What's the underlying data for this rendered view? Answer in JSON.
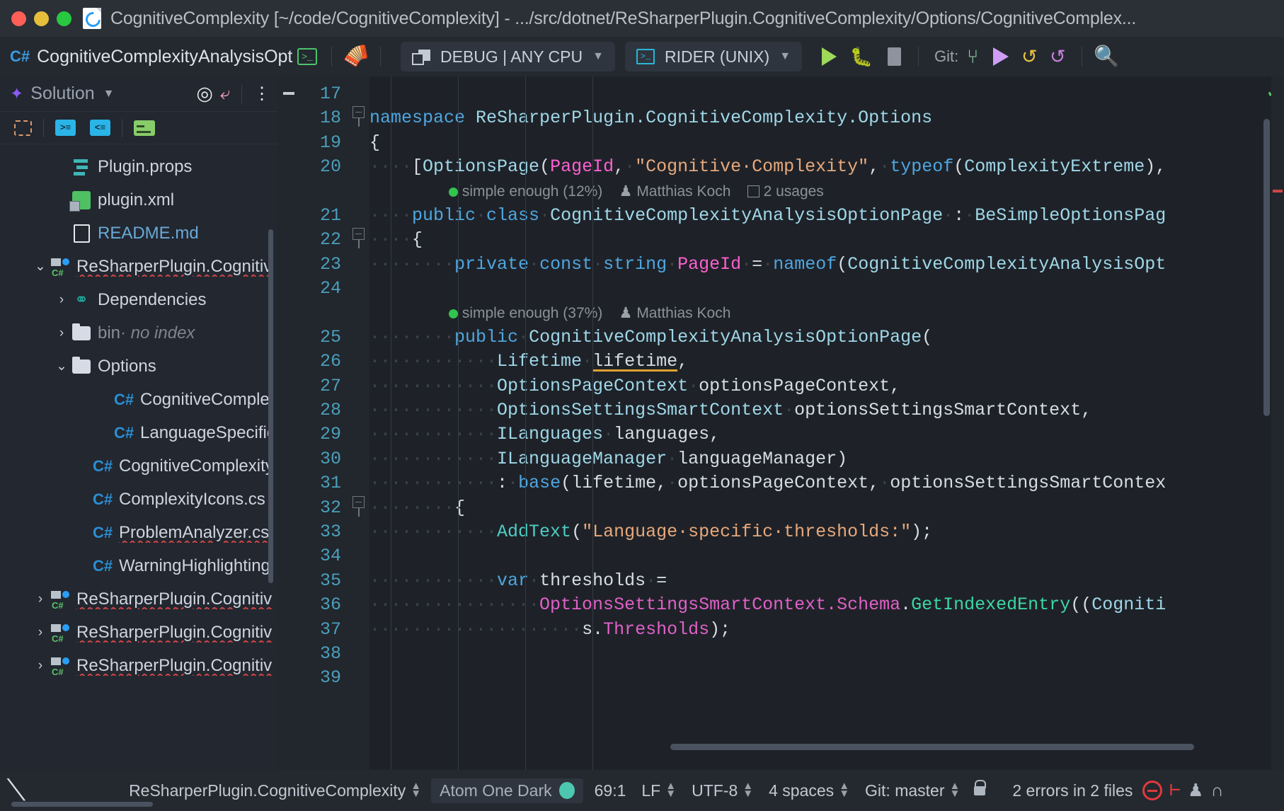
{
  "titlebar": {
    "title": "CognitiveComplexity [~/code/CognitiveComplexity] - .../src/dotnet/ReSharperPlugin.CognitiveComplexity/Options/CognitiveComplex...",
    "window_controls": [
      "close",
      "minimize",
      "maximize"
    ],
    "project_icon": "rider-project-icon"
  },
  "toolbar": {
    "file_badge": "C#",
    "file_name": "CognitiveComplexityAnalysisOptionP",
    "terminal_icon": "terminal-icon",
    "build_icon": "hammer-icon",
    "config_label": "DEBUG | ANY CPU",
    "run_config_label": "RIDER (UNIX)",
    "run_label": "run-button",
    "debug_label": "debug-button",
    "stop_label": "stop-button",
    "git_label": "Git:",
    "git_branch_icon": "branch-icon",
    "git_push_icon": "push-icon",
    "git_update_icon": "update-project-icon",
    "git_history_icon": "rollback-icon",
    "search_icon": "search-everywhere-icon"
  },
  "sidebar": {
    "title": "Solution",
    "logo_icon": "solution-icon",
    "chevron_icon": "chevron-down-icon",
    "header_actions": [
      "locate-icon",
      "collapse-all-icon",
      "options-menu-icon"
    ],
    "toolbar_actions": [
      "select-opened-file-icon",
      "expand-icon",
      "collapse-icon",
      "settings-file-icon"
    ],
    "tree": [
      {
        "label": "Plugin.props",
        "icon": "props-file-icon",
        "indent": 2,
        "twisty": "none",
        "style": "normal"
      },
      {
        "label": "plugin.xml",
        "icon": "xml-file-icon",
        "indent": 2,
        "twisty": "none",
        "style": "normal"
      },
      {
        "label": "README.md",
        "icon": "markdown-file-icon",
        "indent": 2,
        "twisty": "none",
        "style": "link"
      },
      {
        "label": "ReSharperPlugin.Cognitiv",
        "icon": "csproj-icon",
        "indent": 1,
        "twisty": "expanded",
        "style": "squiggle"
      },
      {
        "label": "Dependencies",
        "icon": "dependencies-icon",
        "indent": 2,
        "twisty": "collapsed",
        "style": "normal"
      },
      {
        "label": "bin",
        "suffix": " · no index",
        "icon": "folder-icon",
        "indent": 2,
        "twisty": "collapsed",
        "style": "dim"
      },
      {
        "label": "Options",
        "icon": "folder-icon",
        "indent": 2,
        "twisty": "expanded",
        "style": "normal"
      },
      {
        "label": "CognitiveComplexity",
        "icon": "cs-file-icon",
        "indent": 4,
        "twisty": "none",
        "style": "normal"
      },
      {
        "label": "LanguageSpecificCo",
        "icon": "cs-file-icon",
        "indent": 4,
        "twisty": "none",
        "style": "normal"
      },
      {
        "label": "CognitiveComplexityAr",
        "icon": "cs-file-icon",
        "indent": 3,
        "twisty": "none",
        "style": "normal"
      },
      {
        "label": "ComplexityIcons.cs",
        "icon": "cs-file-icon",
        "indent": 3,
        "twisty": "none",
        "style": "normal"
      },
      {
        "label": "ProblemAnalyzer.cs",
        "icon": "cs-file-icon",
        "indent": 3,
        "twisty": "none",
        "style": "squiggle"
      },
      {
        "label": "WarningHighlighting.c",
        "icon": "cs-file-icon",
        "indent": 3,
        "twisty": "none",
        "style": "normal"
      },
      {
        "label": "ReSharperPlugin.Cognitiv",
        "icon": "csproj-icon",
        "indent": 1,
        "twisty": "collapsed",
        "style": "squiggle"
      },
      {
        "label": "ReSharperPlugin.Cognitiv",
        "icon": "csproj-icon",
        "indent": 1,
        "twisty": "collapsed",
        "style": "squiggle"
      },
      {
        "label": "ReSharperPlugin.Cognitiv",
        "icon": "csproj-icon",
        "indent": 1,
        "twisty": "collapsed",
        "style": "squiggle"
      }
    ]
  },
  "editor": {
    "line_numbers": [
      "17",
      "18",
      "19",
      "20",
      "21",
      "22",
      "23",
      "24",
      "25",
      "26",
      "27",
      "28",
      "29",
      "30",
      "31",
      "32",
      "33",
      "34",
      "35",
      "36",
      "37",
      "38",
      "39"
    ],
    "lines": [
      {
        "num": "17",
        "segments": []
      },
      {
        "num": "18",
        "segments": [
          {
            "t": "namespace",
            "c": "kw"
          },
          {
            "t": " ",
            "c": "dots"
          },
          {
            "t": "ReSharperPlugin.CognitiveComplexity.Options",
            "c": "type"
          }
        ]
      },
      {
        "num": "19",
        "segments": [
          {
            "t": "{",
            "c": "plain"
          }
        ]
      },
      {
        "num": "20",
        "segments": [
          {
            "t": "····",
            "c": "dots"
          },
          {
            "t": "[",
            "c": "plain"
          },
          {
            "t": "OptionsPage",
            "c": "type"
          },
          {
            "t": "(",
            "c": "plain"
          },
          {
            "t": "PageId",
            "c": "magenta"
          },
          {
            "t": ",",
            "c": "plain"
          },
          {
            "t": "·",
            "c": "dots"
          },
          {
            "t": "\"Cognitive·Complexity\"",
            "c": "str"
          },
          {
            "t": ",",
            "c": "plain"
          },
          {
            "t": "·",
            "c": "dots"
          },
          {
            "t": "typeof",
            "c": "kw"
          },
          {
            "t": "(",
            "c": "plain"
          },
          {
            "t": "ComplexityExtreme",
            "c": "type"
          },
          {
            "t": ")",
            "c": "plain"
          },
          {
            "t": ",",
            "c": "plain"
          }
        ]
      },
      {
        "num": "",
        "hint": true,
        "codelens": {
          "complexity": "simple enough (12%)",
          "author": "Matthias Koch",
          "usages": "2 usages"
        }
      },
      {
        "num": "21",
        "segments": [
          {
            "t": "····",
            "c": "dots"
          },
          {
            "t": "public",
            "c": "kw"
          },
          {
            "t": "·",
            "c": "dots"
          },
          {
            "t": "class",
            "c": "kw"
          },
          {
            "t": "·",
            "c": "dots"
          },
          {
            "t": "CognitiveComplexityAnalysisOptionPage",
            "c": "type"
          },
          {
            "t": "·",
            "c": "dots"
          },
          {
            "t": ":",
            "c": "plain"
          },
          {
            "t": "·",
            "c": "dots"
          },
          {
            "t": "BeSimpleOptionsPag",
            "c": "type"
          }
        ]
      },
      {
        "num": "22",
        "segments": [
          {
            "t": "····",
            "c": "dots"
          },
          {
            "t": "{",
            "c": "plain"
          }
        ]
      },
      {
        "num": "23",
        "segments": [
          {
            "t": "········",
            "c": "dots"
          },
          {
            "t": "private",
            "c": "kw"
          },
          {
            "t": "·",
            "c": "dots"
          },
          {
            "t": "const",
            "c": "kw"
          },
          {
            "t": "·",
            "c": "dots"
          },
          {
            "t": "string",
            "c": "kw"
          },
          {
            "t": "·",
            "c": "dots"
          },
          {
            "t": "PageId",
            "c": "magenta"
          },
          {
            "t": "·",
            "c": "dots"
          },
          {
            "t": "=",
            "c": "plain"
          },
          {
            "t": "·",
            "c": "dots"
          },
          {
            "t": "nameof",
            "c": "kw"
          },
          {
            "t": "(",
            "c": "plain"
          },
          {
            "t": "CognitiveComplexityAnalysisOpt",
            "c": "type"
          }
        ]
      },
      {
        "num": "24",
        "segments": []
      },
      {
        "num": "",
        "hint": true,
        "codelens": {
          "complexity": "simple enough (37%)",
          "author": "Matthias Koch",
          "usages": ""
        }
      },
      {
        "num": "25",
        "segments": [
          {
            "t": "········",
            "c": "dots"
          },
          {
            "t": "public",
            "c": "kw"
          },
          {
            "t": "·",
            "c": "dots"
          },
          {
            "t": "CognitiveComplexityAnalysisOptionPage",
            "c": "type"
          },
          {
            "t": "(",
            "c": "plain"
          }
        ]
      },
      {
        "num": "26",
        "segments": [
          {
            "t": "············",
            "c": "dots"
          },
          {
            "t": "Lifetime",
            "c": "type"
          },
          {
            "t": "·",
            "c": "dots"
          },
          {
            "t": "lifetime",
            "c": "plain und-orange"
          },
          {
            "t": ",",
            "c": "plain"
          }
        ]
      },
      {
        "num": "27",
        "segments": [
          {
            "t": "············",
            "c": "dots"
          },
          {
            "t": "OptionsPageContext",
            "c": "type"
          },
          {
            "t": "·",
            "c": "dots"
          },
          {
            "t": "optionsPageContext",
            "c": "plain"
          },
          {
            "t": ",",
            "c": "plain"
          }
        ]
      },
      {
        "num": "28",
        "segments": [
          {
            "t": "············",
            "c": "dots"
          },
          {
            "t": "OptionsSettingsSmartContext",
            "c": "type"
          },
          {
            "t": "·",
            "c": "dots"
          },
          {
            "t": "optionsSettingsSmartContext",
            "c": "plain"
          },
          {
            "t": ",",
            "c": "plain"
          }
        ]
      },
      {
        "num": "29",
        "segments": [
          {
            "t": "············",
            "c": "dots"
          },
          {
            "t": "ILanguages",
            "c": "type"
          },
          {
            "t": "·",
            "c": "dots"
          },
          {
            "t": "languages",
            "c": "plain"
          },
          {
            "t": ",",
            "c": "plain"
          }
        ]
      },
      {
        "num": "30",
        "segments": [
          {
            "t": "············",
            "c": "dots"
          },
          {
            "t": "ILanguageManager",
            "c": "type"
          },
          {
            "t": "·",
            "c": "dots"
          },
          {
            "t": "languageManager",
            "c": "plain"
          },
          {
            "t": ")",
            "c": "plain"
          }
        ]
      },
      {
        "num": "31",
        "segments": [
          {
            "t": "············",
            "c": "dots"
          },
          {
            "t": ":",
            "c": "plain"
          },
          {
            "t": "·",
            "c": "dots"
          },
          {
            "t": "base",
            "c": "kw"
          },
          {
            "t": "(",
            "c": "plain"
          },
          {
            "t": "lifetime,",
            "c": "plain"
          },
          {
            "t": "·",
            "c": "dots"
          },
          {
            "t": "optionsPageContext,",
            "c": "plain"
          },
          {
            "t": "·",
            "c": "dots"
          },
          {
            "t": "optionsSettingsSmartContex",
            "c": "plain"
          }
        ]
      },
      {
        "num": "32",
        "segments": [
          {
            "t": "········",
            "c": "dots"
          },
          {
            "t": "{",
            "c": "plain"
          }
        ]
      },
      {
        "num": "33",
        "segments": [
          {
            "t": "············",
            "c": "dots"
          },
          {
            "t": "AddText",
            "c": "meth"
          },
          {
            "t": "(",
            "c": "plain"
          },
          {
            "t": "\"Language·specific·thresholds:\"",
            "c": "str"
          },
          {
            "t": ")",
            "c": "plain"
          },
          {
            "t": ";",
            "c": "plain"
          }
        ]
      },
      {
        "num": "34",
        "segments": []
      },
      {
        "num": "35",
        "segments": [
          {
            "t": "············",
            "c": "dots"
          },
          {
            "t": "var",
            "c": "kw"
          },
          {
            "t": "·",
            "c": "dots"
          },
          {
            "t": "thresholds",
            "c": "plain"
          },
          {
            "t": "·",
            "c": "dots"
          },
          {
            "t": "=",
            "c": "plain"
          }
        ]
      },
      {
        "num": "36",
        "segments": [
          {
            "t": "················",
            "c": "dots"
          },
          {
            "t": "OptionsSettingsSmartContext.Schema",
            "c": "pink"
          },
          {
            "t": ".",
            "c": "plain"
          },
          {
            "t": "GetIndexedEntry",
            "c": "greenm"
          },
          {
            "t": "((",
            "c": "plain"
          },
          {
            "t": "Cogniti",
            "c": "type"
          }
        ]
      },
      {
        "num": "37",
        "segments": [
          {
            "t": "····················",
            "c": "dots"
          },
          {
            "t": "s",
            "c": "plain"
          },
          {
            "t": ".",
            "c": "plain"
          },
          {
            "t": "Thresholds",
            "c": "pink"
          },
          {
            "t": ")",
            "c": "plain"
          },
          {
            "t": ";",
            "c": "plain"
          }
        ]
      },
      {
        "num": "38",
        "segments": []
      },
      {
        "num": "39",
        "segments": []
      }
    ],
    "analysis_status_icon": "inspection-ok-icon"
  },
  "statusbar": {
    "hide_icon": "hide-notifications-icon",
    "scope": "ReSharperPlugin.CognitiveComplexity",
    "theme": "Atom One Dark",
    "caret_position": "69:1",
    "line_separator": "LF",
    "encoding": "UTF-8",
    "indent": "4 spaces",
    "branch": "Git: master",
    "lock_icon": "unlocked-icon",
    "errors": "2 errors in 2 files",
    "error_icon": "error-circle-icon",
    "plugin_icon": "plugin-indicator-icon",
    "person_icon": "person-icon",
    "memory_icon": "memory-indicator-icon"
  }
}
